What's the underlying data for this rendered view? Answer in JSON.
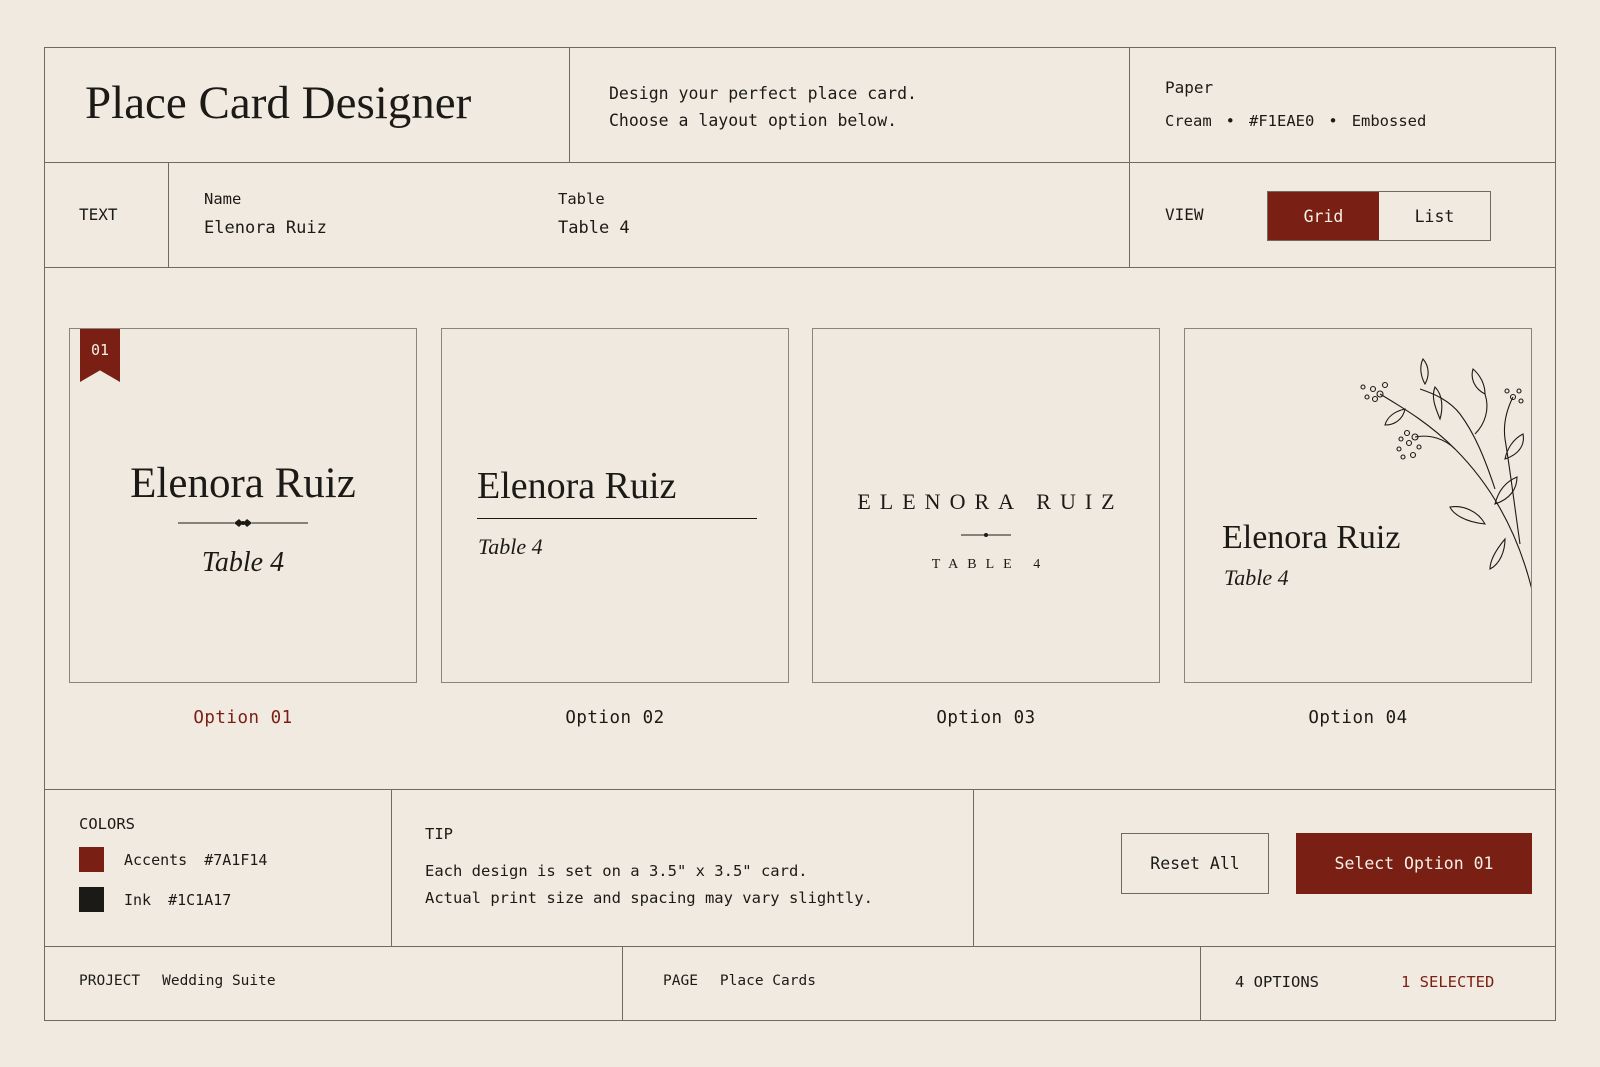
{
  "header": {
    "title": "Place Card Designer",
    "description_line1": "Design your perfect place card.",
    "description_line2": "Choose a layout option below.",
    "paper_label": "Paper",
    "paper_name": "Cream",
    "paper_hex": "#F1EAE0",
    "paper_finish": "Embossed"
  },
  "text_panel": {
    "label": "TEXT",
    "name_label": "Name",
    "name_value": "Elenora Ruiz",
    "table_label": "Table",
    "table_value": "Table 4"
  },
  "view": {
    "label": "VIEW",
    "options": [
      "Grid",
      "List"
    ],
    "selected": "Grid"
  },
  "cards": [
    {
      "badge": "01",
      "name": "Elenora Ruiz",
      "table": "Table 4",
      "option_label": "Option 01",
      "selected": true
    },
    {
      "name": "Elenora Ruiz",
      "table": "Table 4",
      "option_label": "Option 02",
      "selected": false
    },
    {
      "name": "ELENORA RUIZ",
      "table": "TABLE 4",
      "option_label": "Option 03",
      "selected": false
    },
    {
      "name": "Elenora Ruiz",
      "table": "Table 4",
      "option_label": "Option 04",
      "selected": false
    }
  ],
  "colors": {
    "label": "COLORS",
    "items": [
      {
        "name": "Accents",
        "hex": "#7A1F14"
      },
      {
        "name": "Ink",
        "hex": "#1C1A17"
      }
    ]
  },
  "tip": {
    "label": "TIP",
    "line1": "Each design is set on a 3.5\" x 3.5\" card.",
    "line2": "Actual print size and spacing may vary slightly."
  },
  "actions": {
    "reset_label": "Reset All",
    "select_label": "Select Option 01"
  },
  "footer": {
    "project_label": "PROJECT",
    "project_value": "Wedding Suite",
    "page_label": "PAGE",
    "page_value": "Place Cards",
    "options_count": "4 OPTIONS",
    "selected_count": "1 SELECTED"
  },
  "theme": {
    "accent": "#7A1F14",
    "ink": "#1C1A17",
    "paper": "#F1EAE0"
  }
}
